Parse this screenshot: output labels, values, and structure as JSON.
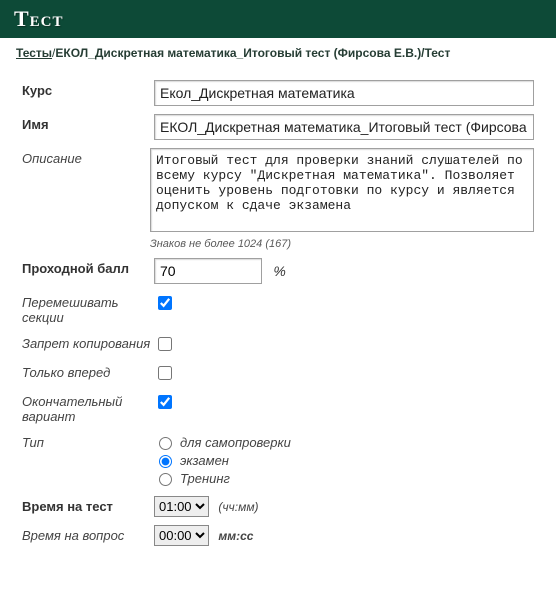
{
  "header": {
    "title": "Тест"
  },
  "breadcrumb": {
    "link": "Тесты",
    "current": "ЕКОЛ_Дискретная математика_Итоговый тест (Фирсова Е.В.)/Тест"
  },
  "form": {
    "course": {
      "label": "Курс",
      "value": "Екол_Дискретная математика"
    },
    "name": {
      "label": "Имя",
      "value": "ЕКОЛ_Дискретная математика_Итоговый тест (Фирсова Е."
    },
    "descr": {
      "label": "Описание",
      "value": "Итоговый тест для проверки знаний слушателей по всему курсу \"Дискретная математика\". Позволяет оценить уровень подготовки по курсу и является допуском к сдаче экзамена",
      "hint": "Знаков не более 1024 (167)"
    },
    "pass": {
      "label": "Проходной балл",
      "value": "70",
      "unit": "%"
    },
    "shuffle": {
      "label": "Перемешивать секции",
      "checked": true
    },
    "nocopy": {
      "label": "Запрет копирования",
      "checked": false
    },
    "forward": {
      "label": "Только вперед",
      "checked": false
    },
    "final": {
      "label": "Окончательный вариант",
      "checked": true
    },
    "type": {
      "label": "Тип",
      "options": [
        {
          "label": "для самопроверки",
          "value": "self",
          "checked": false
        },
        {
          "label": "экзамен",
          "value": "exam",
          "checked": true
        },
        {
          "label": "Тренинг",
          "value": "train",
          "checked": false
        }
      ]
    },
    "testTime": {
      "label": "Время на тест",
      "value": "01:00",
      "unit": "(чч:мм)"
    },
    "qTime": {
      "label": "Время на вопрос",
      "value": "00:00",
      "unit": "мм:сс"
    }
  }
}
